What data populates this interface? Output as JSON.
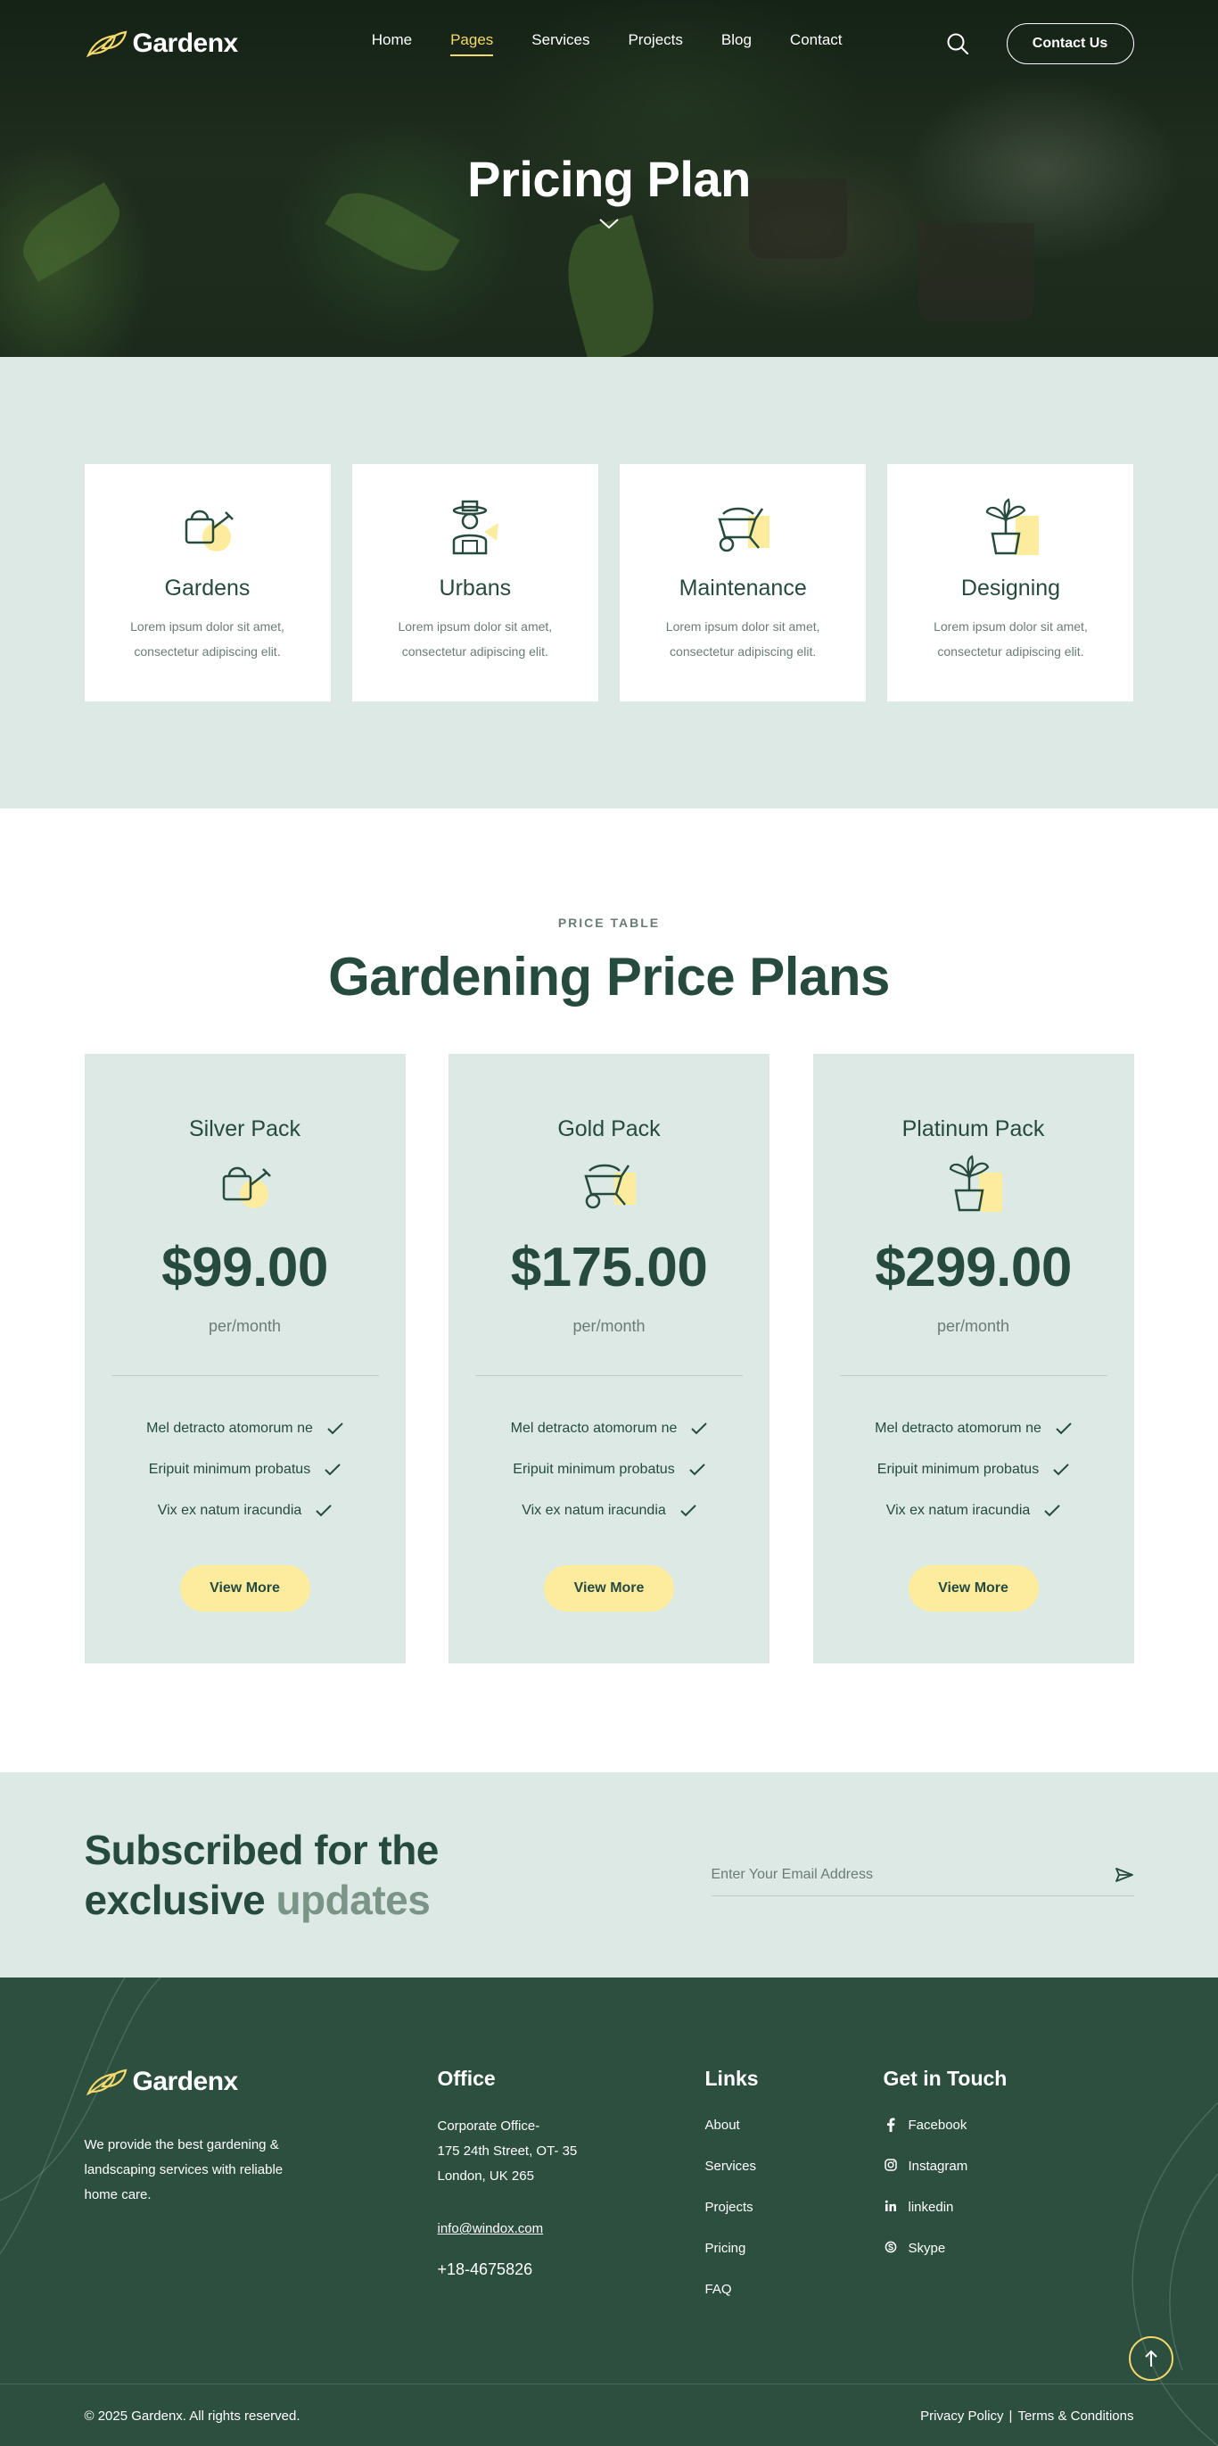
{
  "brand": {
    "name": "Gardenx"
  },
  "nav": {
    "items": [
      {
        "label": "Home",
        "active": false
      },
      {
        "label": "Pages",
        "active": true
      },
      {
        "label": "Services",
        "active": false
      },
      {
        "label": "Projects",
        "active": false
      },
      {
        "label": "Blog",
        "active": false
      },
      {
        "label": "Contact",
        "active": false
      }
    ],
    "contact_label": "Contact Us",
    "search_icon": "search-icon"
  },
  "hero": {
    "title": "Pricing Plan"
  },
  "services": [
    {
      "title": "Gardens",
      "desc": "Lorem ipsum dolor sit amet, consectetur adipiscing elit.",
      "icon": "watering-can-icon"
    },
    {
      "title": "Urbans",
      "desc": "Lorem ipsum dolor sit amet, consectetur adipiscing elit.",
      "icon": "gardener-icon"
    },
    {
      "title": "Maintenance",
      "desc": "Lorem ipsum dolor sit amet, consectetur adipiscing elit.",
      "icon": "wheelbarrow-icon"
    },
    {
      "title": "Designing",
      "desc": "Lorem ipsum dolor sit amet, consectetur adipiscing elit.",
      "icon": "potted-plant-icon"
    }
  ],
  "pricing": {
    "eyebrow": "PRICE TABLE",
    "title": "Gardening Price Plans",
    "plans": [
      {
        "name": "Silver Pack",
        "price": "$99.00",
        "period": "per/month",
        "icon": "watering-can-icon",
        "features": [
          "Mel detracto atomorum ne",
          "Eripuit minimum probatus",
          "Vix ex natum iracundia"
        ],
        "button": "View More"
      },
      {
        "name": "Gold Pack",
        "price": "$175.00",
        "period": "per/month",
        "icon": "wheelbarrow-icon",
        "features": [
          "Mel detracto atomorum ne",
          "Eripuit minimum probatus",
          "Vix ex natum iracundia"
        ],
        "button": "View More"
      },
      {
        "name": "Platinum Pack",
        "price": "$299.00",
        "period": "per/month",
        "icon": "potted-plant-icon",
        "features": [
          "Mel detracto atomorum ne",
          "Eripuit minimum probatus",
          "Vix ex natum iracundia"
        ],
        "button": "View More"
      }
    ]
  },
  "subscribe": {
    "title_line1": "Subscribed for the",
    "title_line2_a": "exclusive",
    "title_line2_b": "updates",
    "placeholder": "Enter Your Email Address"
  },
  "footer": {
    "description": "We provide the best gardening & landscaping services with reliable home care.",
    "office": {
      "heading": "Office",
      "line1": "Corporate Office-",
      "line2": "175 24th Street, OT- 35",
      "line3": "London, UK 265",
      "email": "info@windox.com",
      "phone": "+18-4675826"
    },
    "links": {
      "heading": "Links",
      "items": [
        "About",
        "Services",
        "Projects",
        "Pricing",
        "FAQ"
      ]
    },
    "touch": {
      "heading": "Get in Touch",
      "items": [
        {
          "label": "Facebook",
          "icon": "facebook-icon"
        },
        {
          "label": "Instagram",
          "icon": "instagram-icon"
        },
        {
          "label": "linkedin",
          "icon": "linkedin-icon"
        },
        {
          "label": "Skype",
          "icon": "skype-icon"
        }
      ]
    },
    "copyright": "© 2025 Gardenx. All rights reserved.",
    "privacy": "Privacy Policy",
    "separator": "|",
    "terms": "Terms & Conditions"
  },
  "colors": {
    "primary": "#264b3e",
    "accent": "#f5d96a",
    "button_fill": "#fdec9e",
    "light_bg": "#dde9e5",
    "footer_bg": "#2c4f3f"
  }
}
